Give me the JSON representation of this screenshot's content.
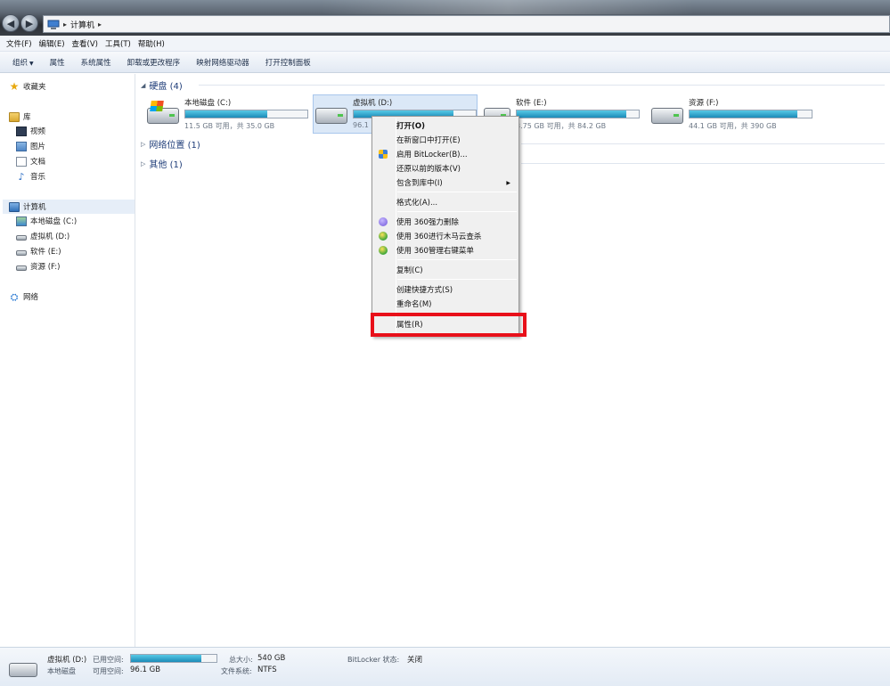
{
  "address": {
    "root_icon": "computer-icon",
    "location": "计算机"
  },
  "menubar": [
    "文件(F)",
    "编辑(E)",
    "查看(V)",
    "工具(T)",
    "帮助(H)"
  ],
  "toolbar": {
    "organize": "组织",
    "items": [
      "属性",
      "系统属性",
      "卸载或更改程序",
      "映射网络驱动器",
      "打开控制面板"
    ]
  },
  "nav": {
    "favorites": "收藏夹",
    "libraries": "库",
    "library_items": [
      "视频",
      "图片",
      "文档",
      "音乐"
    ],
    "computer": "计算机",
    "drives": [
      "本地磁盘 (C:)",
      "虚拟机 (D:)",
      "软件 (E:)",
      "资源 (F:)"
    ],
    "network": "网络"
  },
  "groups": {
    "hard_disks": "硬盘 (4)",
    "network_locations": "网络位置 (1)",
    "others": "其他 (1)"
  },
  "drives": [
    {
      "name": "本地磁盘 (C:)",
      "space": "11.5 GB 可用，共 35.0 GB",
      "used_fraction": 0.67
    },
    {
      "name": "虚拟机 (D:)",
      "space": "96.1",
      "used_fraction": 0.82
    },
    {
      "name": "软件 (E:)",
      "space": "3.75 GB 可用，共 84.2 GB",
      "used_fraction": 0.9
    },
    {
      "name": "资源 (F:)",
      "space": "44.1 GB 可用，共 390 GB",
      "used_fraction": 0.88
    }
  ],
  "context_menu": {
    "open": "打开(O)",
    "open_new_window": "在新窗口中打开(E)",
    "bitlocker": "启用 BitLocker(B)...",
    "restore": "还原以前的版本(V)",
    "include_library": "包含到库中(I)",
    "format": "格式化(A)...",
    "force_delete": "使用 360强力删除",
    "trojan_scan": "使用 360进行木马云查杀",
    "manage_menu": "使用 360管理右键菜单",
    "copy": "复制(C)",
    "create_shortcut": "创建快捷方式(S)",
    "rename": "重命名(M)",
    "properties": "属性(R)"
  },
  "details": {
    "drive_name": "虚拟机 (D:)",
    "used_label": "已用空间:",
    "type": "本地磁盘",
    "free_label": "可用空间:",
    "free_value": "96.1 GB",
    "total_label": "总大小:",
    "total_value": "540 GB",
    "fs_label": "文件系统:",
    "fs_value": "NTFS",
    "bitlocker_label": "BitLocker 状态:",
    "bitlocker_value": "关闭",
    "used_fraction": 0.82
  },
  "colors": {
    "highlight_box": "#e8101a",
    "capacity_bar": "#1b8bb8",
    "group_header": "#1e3c78"
  }
}
